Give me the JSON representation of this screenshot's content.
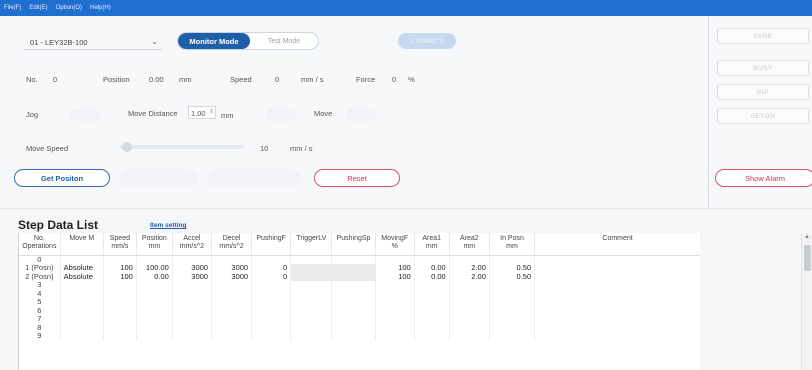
{
  "menu": [
    "File(F)",
    "Edit(E)",
    "Option(O)",
    "Help(H)"
  ],
  "axis": {
    "selected": "01 - LEY32B-100",
    "chevron": "⌄"
  },
  "mode": {
    "monitor": "Monitor Mode",
    "test": "Test Mode"
  },
  "connect_label": "CONNECT",
  "status_buttons": [
    "SVRE",
    "BUSY",
    "INP",
    "SETON"
  ],
  "monitor": {
    "no_label": "No.",
    "no_value": "0",
    "position_label": "Position",
    "position_value": "0.00",
    "position_unit": "mm",
    "speed_label": "Speed",
    "speed_value": "0",
    "speed_unit": "mm / s",
    "force_label": "Force",
    "force_value": "0",
    "force_unit": "%"
  },
  "jog": {
    "label": "Jog",
    "move_distance_label": "Move Distance",
    "move_distance_value": "1.00",
    "move_distance_unit": "mm",
    "move_label": "Move"
  },
  "move_speed": {
    "label": "Move Speed",
    "value": "10",
    "unit": "mm / s",
    "level": 0.02
  },
  "buttons": {
    "get_position": "Get Positon",
    "reset": "Reset",
    "show_alarm": "Show Alarm"
  },
  "step_data": {
    "title": "Step Data List",
    "item_setting": "Item setting",
    "columns": [
      {
        "l1": "No.",
        "l2": "Operations"
      },
      {
        "l1": "Move M",
        "l2": ""
      },
      {
        "l1": "Speed",
        "l2": "mm/s"
      },
      {
        "l1": "Position",
        "l2": "mm"
      },
      {
        "l1": "Accel",
        "l2": "mm/s^2"
      },
      {
        "l1": "Decel",
        "l2": "mm/s^2"
      },
      {
        "l1": "PushingF",
        "l2": ""
      },
      {
        "l1": "TriggerLV",
        "l2": ""
      },
      {
        "l1": "PushingSp",
        "l2": ""
      },
      {
        "l1": "MovingF",
        "l2": "%"
      },
      {
        "l1": "Area1",
        "l2": "mm"
      },
      {
        "l1": "Area2",
        "l2": "mm"
      },
      {
        "l1": "In Posn",
        "l2": "mm"
      },
      {
        "l1": "Comment",
        "l2": ""
      }
    ],
    "rows": [
      [
        "0",
        "",
        "",
        "",
        "",
        "",
        "",
        "",
        "",
        "",
        "",
        "",
        "",
        ""
      ],
      [
        "1 (Posn)",
        "Absolute",
        "100",
        "100.00",
        "3000",
        "3000",
        "0",
        "",
        "",
        "100",
        "0.00",
        "2.00",
        "0.50",
        ""
      ],
      [
        "2 (Posn)",
        "Absolute",
        "100",
        "0.00",
        "3000",
        "3000",
        "0",
        "",
        "",
        "100",
        "0.00",
        "2.00",
        "0.50",
        ""
      ],
      [
        "3",
        "",
        "",
        "",
        "",
        "",
        "",
        "",
        "",
        "",
        "",
        "",
        "",
        ""
      ],
      [
        "4",
        "",
        "",
        "",
        "",
        "",
        "",
        "",
        "",
        "",
        "",
        "",
        "",
        ""
      ],
      [
        "5",
        "",
        "",
        "",
        "",
        "",
        "",
        "",
        "",
        "",
        "",
        "",
        "",
        ""
      ],
      [
        "6",
        "",
        "",
        "",
        "",
        "",
        "",
        "",
        "",
        "",
        "",
        "",
        "",
        ""
      ],
      [
        "7",
        "",
        "",
        "",
        "",
        "",
        "",
        "",
        "",
        "",
        "",
        "",
        "",
        ""
      ],
      [
        "8",
        "",
        "",
        "",
        "",
        "",
        "",
        "",
        "",
        "",
        "",
        "",
        "",
        ""
      ],
      [
        "9",
        "",
        "",
        "",
        "",
        "",
        "",
        "",
        "",
        "",
        "",
        "",
        "",
        ""
      ]
    ]
  },
  "colors": {
    "menubar": "#1f6fd0",
    "accent": "#1f5fa8",
    "reset": "#d03050"
  }
}
